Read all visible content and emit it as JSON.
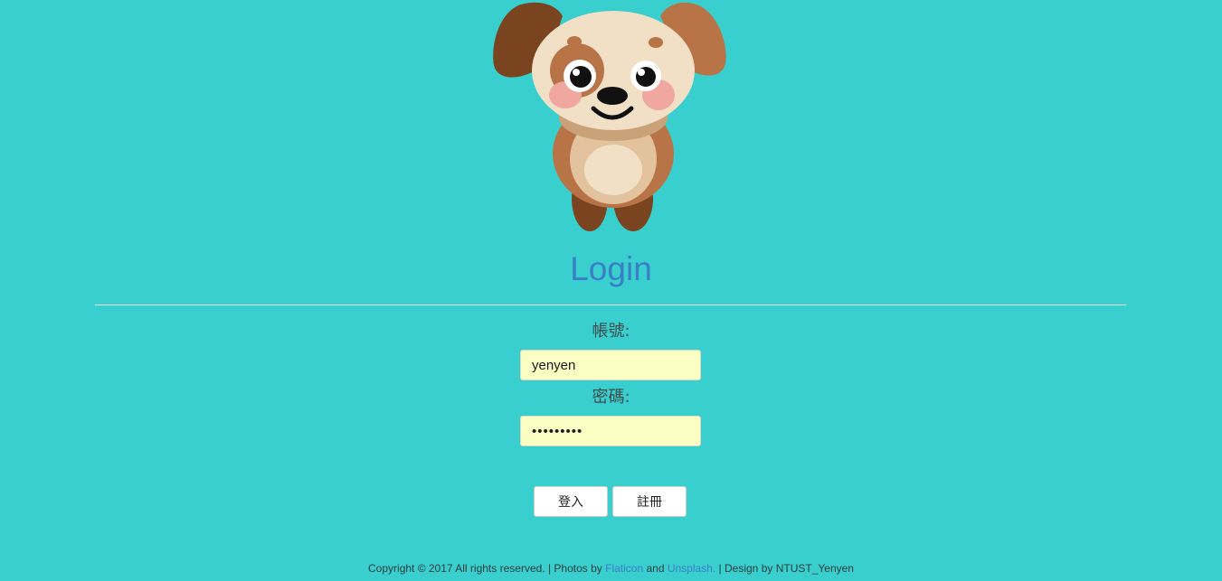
{
  "header": {
    "mascot_icon": "puppy-mascot-icon",
    "title": "Login"
  },
  "form": {
    "account_label": "帳號:",
    "account_value": "yenyen",
    "password_label": "密碼:",
    "password_value": "xxxxxxxxx",
    "login_button": "登入",
    "register_button": "註冊"
  },
  "footer": {
    "copyright": "Copyright © 2017 All rights reserved. | Photos by ",
    "link_flaticon": "Flaticon",
    "and_text": " and ",
    "link_unsplash": "Unsplash.",
    "design_text": " | Design by NTUST_Yenyen"
  },
  "colors": {
    "background": "#39cfcf",
    "title": "#3a7fc6",
    "input_bg": "#fafec3",
    "link": "#3a7fc6"
  }
}
